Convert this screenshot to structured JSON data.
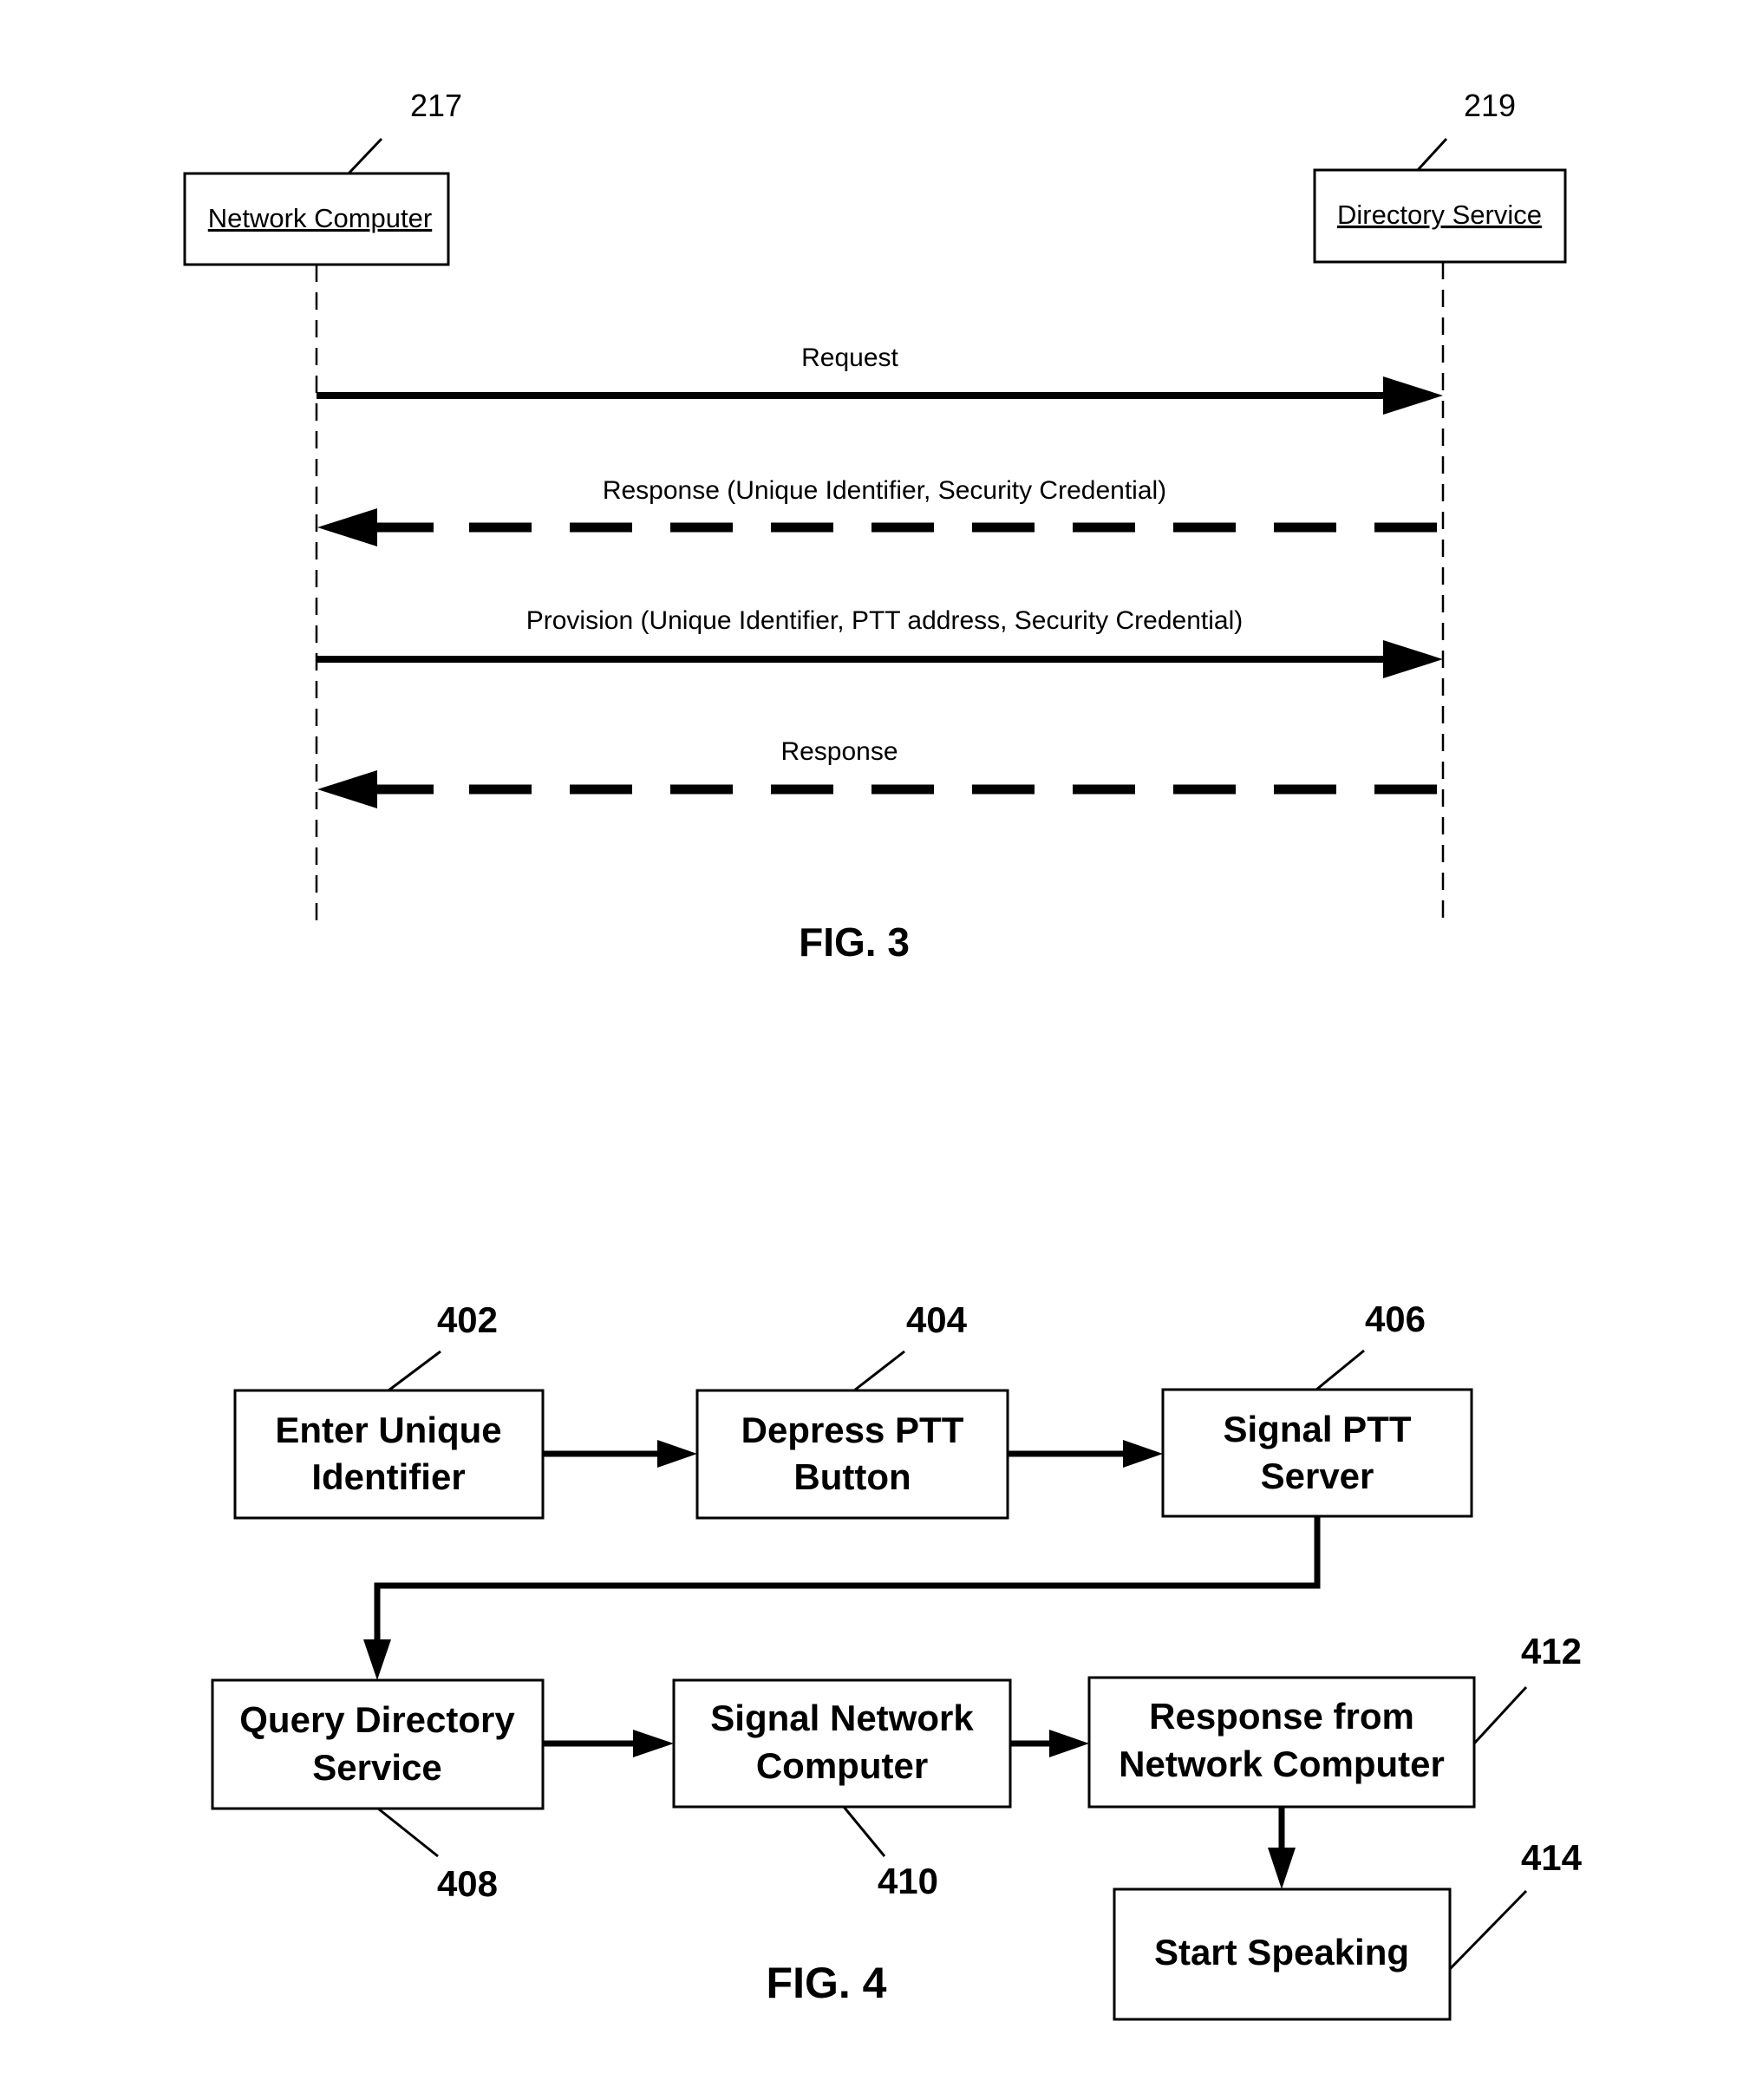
{
  "fig3": {
    "caption": "FIG. 3",
    "participants": [
      {
        "ref": "217",
        "label": "Network Computer"
      },
      {
        "ref": "219",
        "label": "Directory Service"
      }
    ],
    "messages": [
      {
        "label": "Request",
        "direction": "right",
        "style": "solid"
      },
      {
        "label": "Response (Unique Identifier, Security Credential)",
        "direction": "left",
        "style": "dashed"
      },
      {
        "label": "Provision (Unique Identifier, PTT address, Security Credential)",
        "direction": "right",
        "style": "solid"
      },
      {
        "label": "Response",
        "direction": "left",
        "style": "dashed"
      }
    ]
  },
  "fig4": {
    "caption": "FIG. 4",
    "steps": [
      {
        "ref": "402",
        "lines": [
          "Enter Unique",
          "Identifier"
        ]
      },
      {
        "ref": "404",
        "lines": [
          "Depress PTT",
          "Button"
        ]
      },
      {
        "ref": "406",
        "lines": [
          "Signal PTT",
          "Server"
        ]
      },
      {
        "ref": "408",
        "lines": [
          "Query Directory",
          "Service"
        ]
      },
      {
        "ref": "410",
        "lines": [
          "Signal Network",
          "Computer"
        ]
      },
      {
        "ref": "412",
        "lines": [
          "Response from",
          "Network Computer"
        ]
      },
      {
        "ref": "414",
        "lines": [
          "Start Speaking"
        ]
      }
    ]
  }
}
